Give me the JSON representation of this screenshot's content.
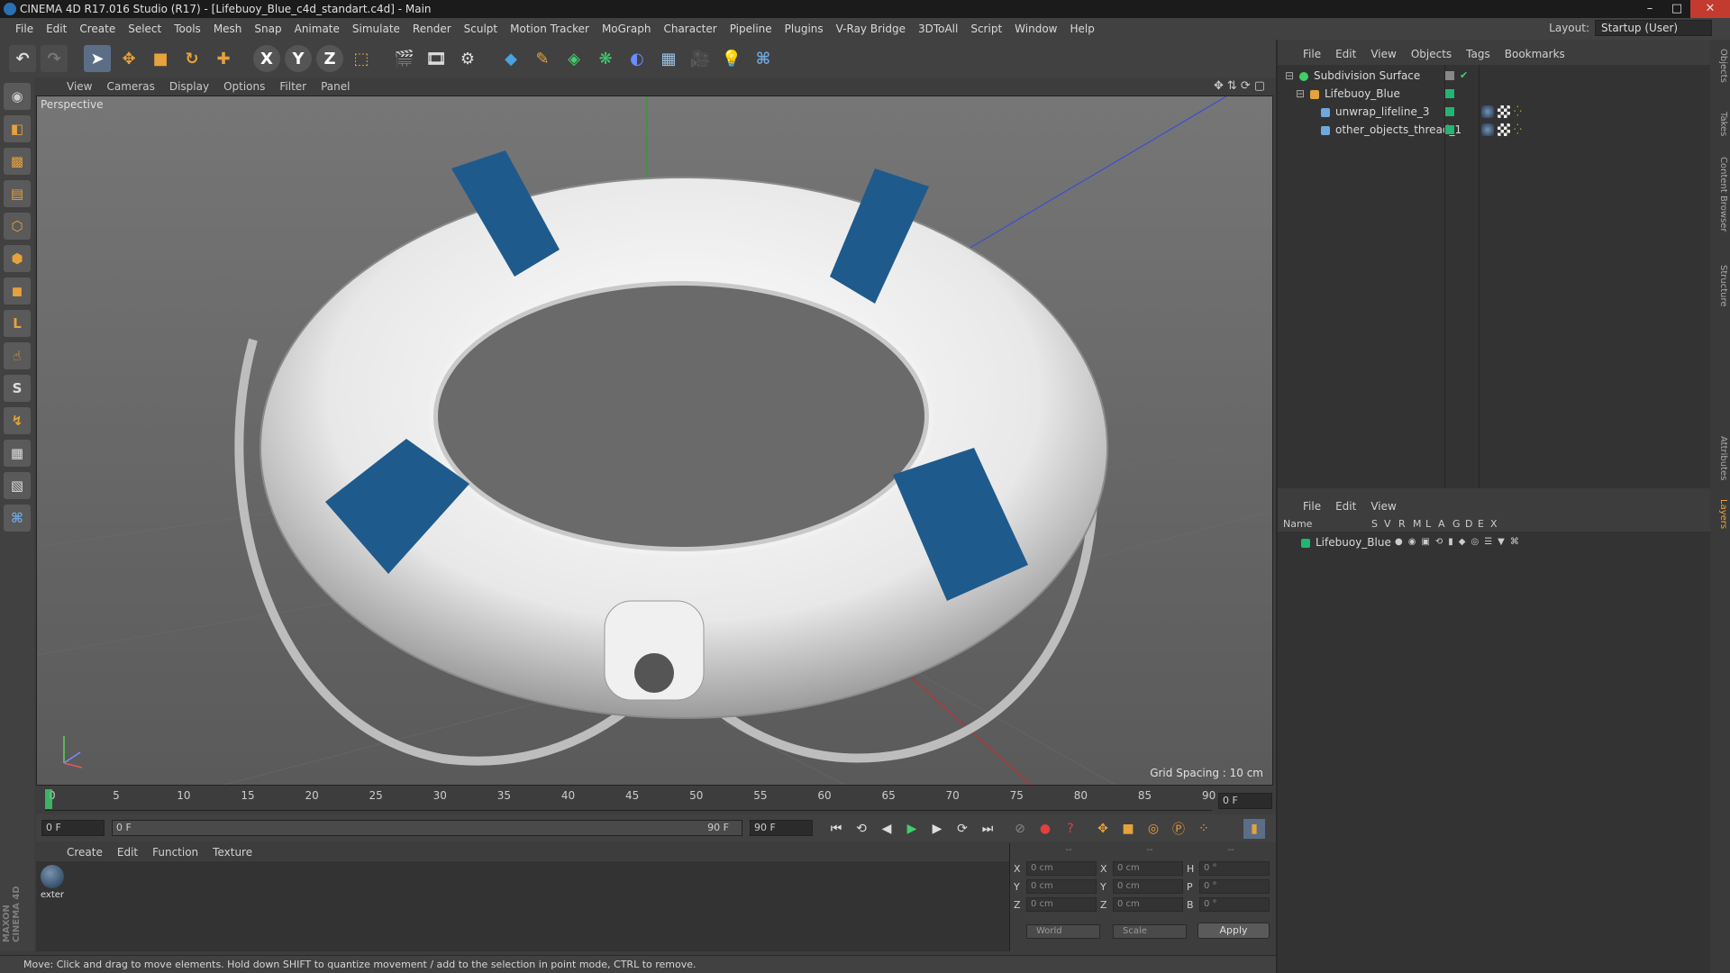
{
  "window": {
    "title": "CINEMA 4D R17.016 Studio (R17) - [Lifebuoy_Blue_c4d_standart.c4d] - Main"
  },
  "menubar": {
    "items": [
      "File",
      "Edit",
      "Create",
      "Select",
      "Tools",
      "Mesh",
      "Snap",
      "Animate",
      "Simulate",
      "Render",
      "Sculpt",
      "Motion Tracker",
      "MoGraph",
      "Character",
      "Pipeline",
      "Plugins",
      "V-Ray Bridge",
      "3DToAll",
      "Script",
      "Window",
      "Help"
    ]
  },
  "layout": {
    "label": "Layout:",
    "value": "Startup (User)"
  },
  "toolbar": {
    "axis_x": "X",
    "axis_y": "Y",
    "axis_z": "Z"
  },
  "viewport": {
    "menu": [
      "View",
      "Cameras",
      "Display",
      "Options",
      "Filter",
      "Panel"
    ],
    "camera_label": "Perspective",
    "grid_spacing": "Grid Spacing : 10 cm"
  },
  "timeline": {
    "ticks": [
      "0",
      "5",
      "10",
      "15",
      "20",
      "25",
      "30",
      "35",
      "40",
      "45",
      "50",
      "55",
      "60",
      "65",
      "70",
      "75",
      "80",
      "85",
      "90"
    ],
    "end_frame": "0 F",
    "start_field": "0 F",
    "range_start": "0 F",
    "range_end": "90 F",
    "end_field": "90 F"
  },
  "material_manager": {
    "menu": [
      "Create",
      "Edit",
      "Function",
      "Texture"
    ],
    "materials": [
      {
        "name": "exter"
      }
    ]
  },
  "coordinates": {
    "header": [
      "--",
      "--",
      "--"
    ],
    "rows": [
      {
        "l1": "X",
        "v1": "0 cm",
        "l2": "X",
        "v2": "0 cm",
        "l3": "H",
        "v3": "0 °"
      },
      {
        "l1": "Y",
        "v1": "0 cm",
        "l2": "Y",
        "v2": "0 cm",
        "l3": "P",
        "v3": "0 °"
      },
      {
        "l1": "Z",
        "v1": "0 cm",
        "l2": "Z",
        "v2": "0 cm",
        "l3": "B",
        "v3": "0 °"
      }
    ],
    "space": "World",
    "mode": "Scale",
    "apply": "Apply"
  },
  "status": {
    "text": "Move: Click and drag to move elements. Hold down SHIFT to quantize movement / add to the selection in point mode, CTRL to remove."
  },
  "object_manager": {
    "menu": [
      "File",
      "Edit",
      "View",
      "Objects",
      "Tags",
      "Bookmarks"
    ],
    "objects": [
      {
        "name": "Subdivision Surface",
        "indent": 0
      },
      {
        "name": "Lifebuoy_Blue",
        "indent": 1
      },
      {
        "name": "unwrap_lifeline_3",
        "indent": 2
      },
      {
        "name": "other_objects_thread_1",
        "indent": 2
      }
    ]
  },
  "layer_manager": {
    "menu": [
      "File",
      "Edit",
      "View"
    ],
    "columns": [
      "Name",
      "S",
      "V",
      "R",
      "M",
      "L",
      "A",
      "G",
      "D",
      "E",
      "X"
    ],
    "layers": [
      {
        "name": "Lifebuoy_Blue"
      }
    ]
  },
  "side_tabs": [
    "Objects",
    "Takes",
    "Content Browser",
    "Structure",
    "Attributes",
    "Layers"
  ],
  "brand": {
    "text": "MAXON CINEMA 4D"
  },
  "colors": {
    "accent_orange": "#e6a23c",
    "layer_green": "#22b573",
    "ring_blue": "#1f5a8c"
  }
}
